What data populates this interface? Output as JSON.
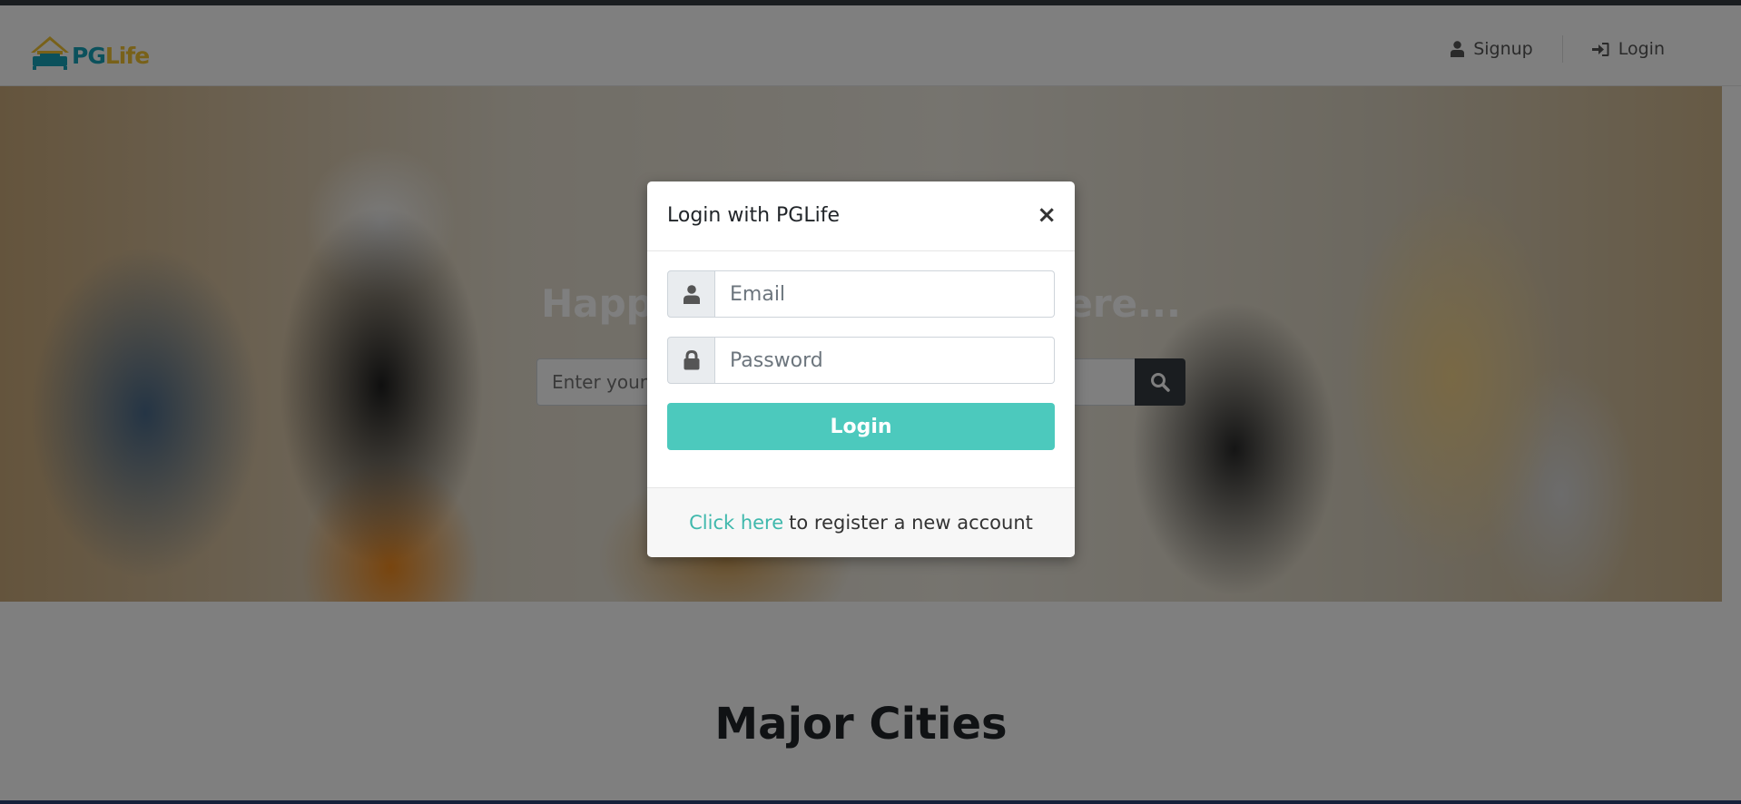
{
  "brand": {
    "pg": "PG",
    "life": "Life"
  },
  "nav": {
    "signup": "Signup",
    "login": "Login"
  },
  "hero": {
    "title": "Happy Hunting Begins Here...",
    "search_placeholder": "Enter your city to search for PGs"
  },
  "sections": {
    "cities_title": "Major Cities"
  },
  "modal": {
    "title": "Login with PGLife",
    "close": "×",
    "email_placeholder": "Email",
    "password_placeholder": "Password",
    "login_button": "Login",
    "footer_link": "Click here",
    "footer_text": "to register a new account"
  },
  "colors": {
    "accent": "#4cc9bd",
    "link": "#3fb8ac",
    "brand_pg": "#17a2b8",
    "brand_life": "#f1c232"
  },
  "icons": {
    "signup": "user-icon",
    "login": "sign-in-icon",
    "search": "search-icon",
    "email": "user-icon",
    "password": "lock-icon"
  }
}
